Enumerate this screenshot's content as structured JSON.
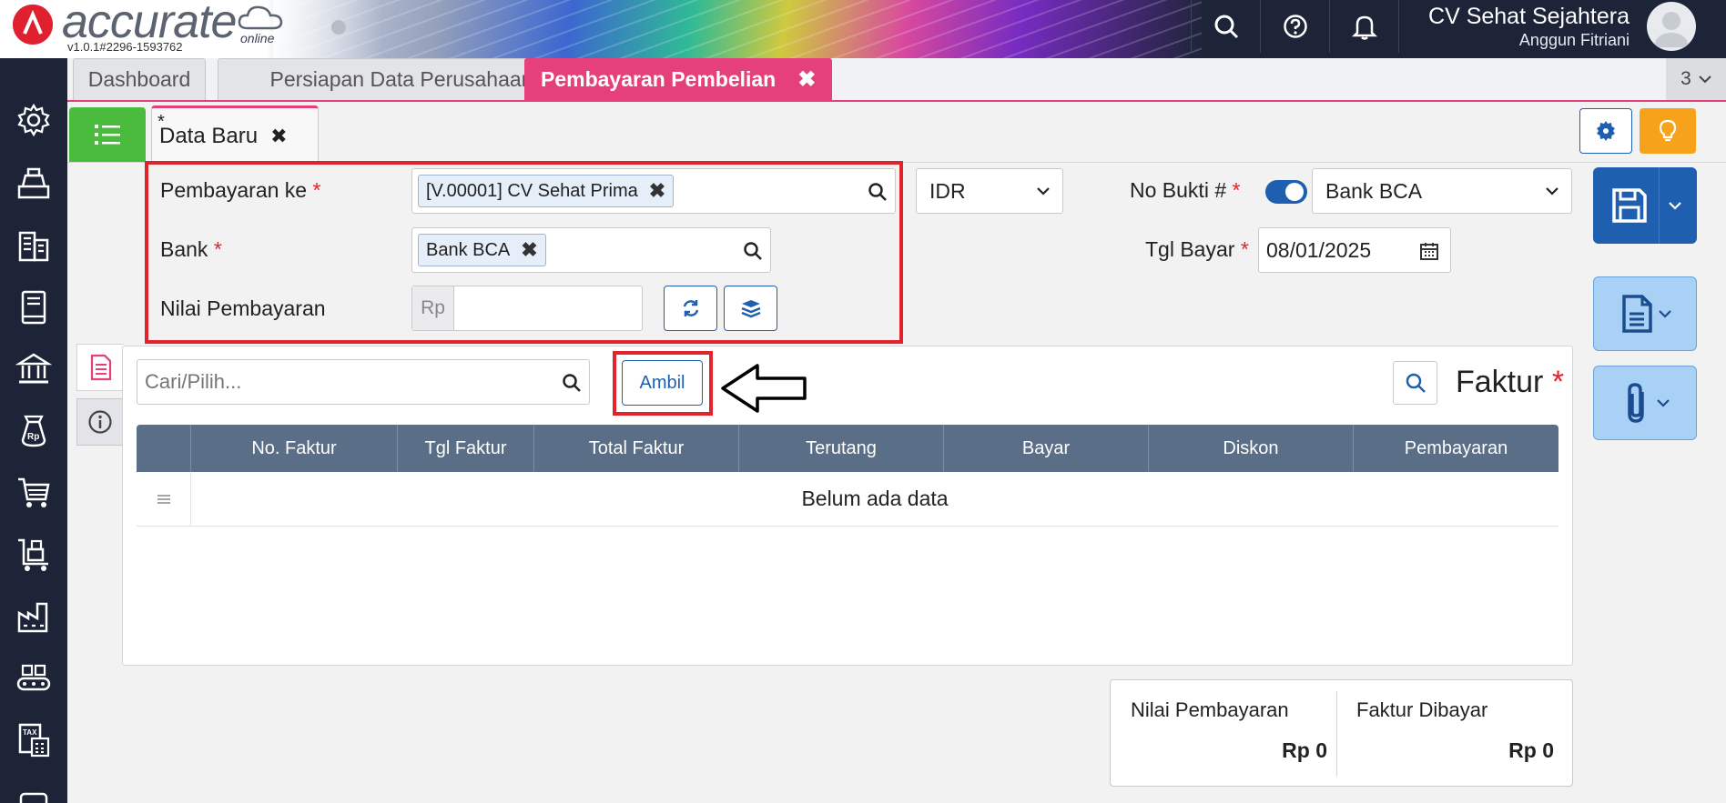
{
  "header": {
    "logo_text": "accurate",
    "logo_sub": "online",
    "version": "v1.0.1#2296-1593762",
    "company": "CV Sehat Sejahtera",
    "user": "Anggun Fitriani"
  },
  "tabs": [
    {
      "label": "Dashboard"
    },
    {
      "label": "Persiapan Data Perusahaan"
    },
    {
      "label": "Pembayaran Pembelian",
      "close": "✖"
    }
  ],
  "tab_count": "3",
  "subtab": {
    "star": "*",
    "label": "Data Baru",
    "close": "✖"
  },
  "form": {
    "pembayaran_ke_label": "Pembayaran ke",
    "required_mark": "*",
    "vendor_chip": "[V.00001] CV Sehat Prima",
    "chip_close": "✖",
    "bank_label": "Bank",
    "bank_chip": "Bank BCA",
    "nilai_label": "Nilai Pembayaran",
    "rp_prefix": "Rp",
    "nilai_value": "",
    "currency": "IDR",
    "no_bukti_label": "No Bukti #",
    "no_bukti_select": "Bank BCA",
    "tgl_bayar_label": "Tgl Bayar",
    "tgl_bayar_value": "08/01/2025"
  },
  "panel": {
    "search_placeholder": "Cari/Pilih...",
    "ambil_label": "Ambil",
    "faktur_title": "Faktur",
    "columns": [
      "No. Faktur",
      "Tgl Faktur",
      "Total Faktur",
      "Terutang",
      "Bayar",
      "Diskon",
      "Pembayaran"
    ],
    "empty_text": "Belum ada data"
  },
  "summary": {
    "nilai_label": "Nilai Pembayaran",
    "nilai_value": "Rp 0",
    "faktur_label": "Faktur Dibayar",
    "faktur_value": "Rp 0"
  },
  "colors": {
    "accent_pink": "#e6407a",
    "brand_blue": "#1f5fb0",
    "sidebar": "#1d2438",
    "highlight_red": "#e1232b"
  }
}
